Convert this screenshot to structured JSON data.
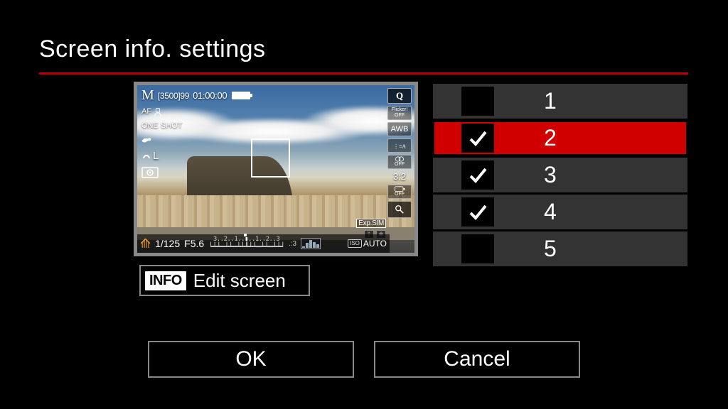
{
  "title": "Screen info. settings",
  "preview": {
    "mode": "M",
    "bracket_value": "[3500]",
    "burst_remaining": "99",
    "rec_time": "01:00:00",
    "af_mode": "AF",
    "drive": "ONE SHOT",
    "quality": "L",
    "shutter": "1/125",
    "aperture": "F5.6",
    "ev_scale_top": "3..2..1..",
    "ev_scale_mid": "..1..2..3",
    "ev_right_label": ".:3",
    "iso_label": "ISO",
    "iso_value": "AUTO",
    "q_button": "Q",
    "flicker_off": "Flicker!\nOFF",
    "awb": "AWB",
    "picstyle": "A",
    "creative_off": "OFF",
    "aspect": "3:2",
    "touch_off": "OFF",
    "expsim": "Exp.SIM"
  },
  "edit": {
    "info_chip": "INFO",
    "label": "Edit screen"
  },
  "screens": [
    {
      "number": "1",
      "checked": false
    },
    {
      "number": "2",
      "checked": true
    },
    {
      "number": "3",
      "checked": true
    },
    {
      "number": "4",
      "checked": true
    },
    {
      "number": "5",
      "checked": false
    }
  ],
  "selected_index": 1,
  "buttons": {
    "ok": "OK",
    "cancel": "Cancel"
  }
}
